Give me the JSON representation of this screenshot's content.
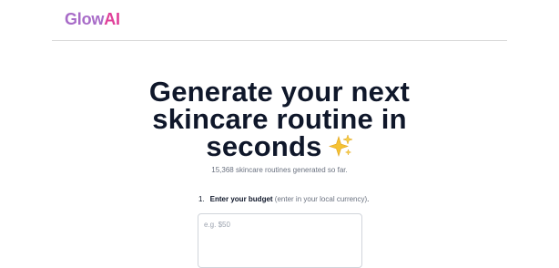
{
  "brand": {
    "part1": "Glow",
    "part2": "AI"
  },
  "hero": {
    "line1": "Generate your next",
    "line2": "skincare routine in",
    "line3": "seconds",
    "sparkle_icon": "sparkles-icon"
  },
  "stats": {
    "text": "15,368 skincare routines generated so far."
  },
  "step1": {
    "number": "1.",
    "label": "Enter your budget",
    "hint": "(enter in your local currency)",
    "suffix": ".",
    "placeholder": "e.g. $50",
    "value": ""
  },
  "colors": {
    "brand_start": "#a86cc8",
    "brand_end": "#e0409a",
    "heading": "#0f172a",
    "muted": "#6b7280",
    "border": "#d1d5db"
  }
}
